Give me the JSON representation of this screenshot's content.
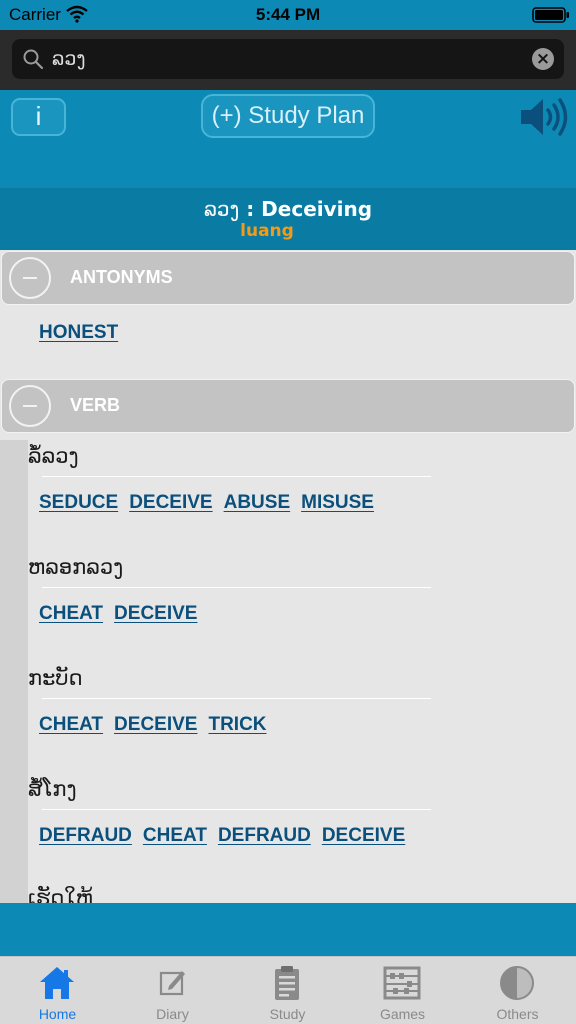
{
  "status_bar": {
    "carrier": "Carrier",
    "time": "5:44 PM"
  },
  "search": {
    "value": "ລວງ",
    "placeholder": ""
  },
  "toolbar": {
    "info_label": "i",
    "study_plan_label": "(+) Study Plan"
  },
  "word": {
    "lao": "ລວງ",
    "separator": " : ",
    "english": "Deceiving",
    "romanization": "luang"
  },
  "sections": {
    "antonyms": {
      "label": "ANTONYMS",
      "links": [
        "HONEST"
      ]
    },
    "verb": {
      "label": "VERB",
      "entries": [
        {
          "lao": "ລໍ້ລວງ",
          "links": [
            "SEDUCE",
            "DECEIVE",
            "ABUSE",
            "MISUSE"
          ]
        },
        {
          "lao": "ຫລອກລວງ",
          "links": [
            "CHEAT",
            "DECEIVE"
          ]
        },
        {
          "lao": "ກະບັດ",
          "links": [
            "CHEAT",
            "DECEIVE",
            "TRICK"
          ]
        },
        {
          "lao": "ສໍ້ໂກງ",
          "links": [
            "DEFRAUD",
            "CHEAT",
            "DEFRAUD",
            "DECEIVE"
          ]
        },
        {
          "lao": "ເຮັດໃຫ້"
        }
      ]
    }
  },
  "tabs": [
    {
      "label": "Home",
      "icon": "home-icon",
      "active": true
    },
    {
      "label": "Diary",
      "icon": "diary-icon"
    },
    {
      "label": "Study",
      "icon": "study-icon"
    },
    {
      "label": "Games",
      "icon": "games-icon"
    },
    {
      "label": "Others",
      "icon": "others-icon"
    }
  ],
  "colors": {
    "primary": "#0c8ab5",
    "header": "#0a7ca3",
    "accent_orange": "#f39b18",
    "link": "#0b4f7c",
    "tab_active": "#1677e6"
  }
}
